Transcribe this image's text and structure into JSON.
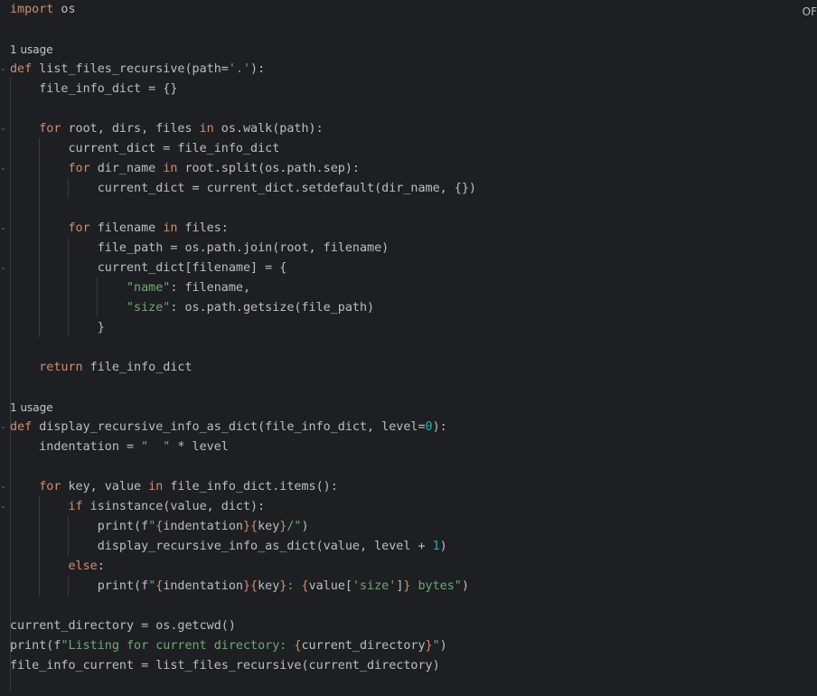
{
  "colors": {
    "background": "#1e1f22",
    "keyword": "#cf8e6d",
    "string": "#6aab73",
    "number": "#2aacb8",
    "text": "#bcbec4",
    "hint": "#c8c8c8"
  },
  "corner_label": "OF",
  "usage_hints": [
    "1 usage",
    "1 usage"
  ],
  "code_lines": [
    [
      {
        "t": "import",
        "c": "kw"
      },
      {
        "t": " os",
        "c": "plain"
      }
    ],
    [
      {
        "t": "def",
        "c": "kw"
      },
      {
        "t": " list_files_recursive(path=",
        "c": "plain"
      },
      {
        "t": "'.'",
        "c": "str"
      },
      {
        "t": "):",
        "c": "plain"
      }
    ],
    [
      {
        "t": "    file_info_dict = {}",
        "c": "plain"
      }
    ],
    [
      {
        "t": "    ",
        "c": "plain"
      },
      {
        "t": "for",
        "c": "kw"
      },
      {
        "t": " root, dirs, files ",
        "c": "plain"
      },
      {
        "t": "in",
        "c": "kw"
      },
      {
        "t": " os.walk(path):",
        "c": "plain"
      }
    ],
    [
      {
        "t": "        current_dict = file_info_dict",
        "c": "plain"
      }
    ],
    [
      {
        "t": "        ",
        "c": "plain"
      },
      {
        "t": "for",
        "c": "kw"
      },
      {
        "t": " dir_name ",
        "c": "plain"
      },
      {
        "t": "in",
        "c": "kw"
      },
      {
        "t": " root.split(os.path.sep):",
        "c": "plain"
      }
    ],
    [
      {
        "t": "            current_dict = current_dict.setdefault(dir_name, {})",
        "c": "plain"
      }
    ],
    [
      {
        "t": "        ",
        "c": "plain"
      },
      {
        "t": "for",
        "c": "kw"
      },
      {
        "t": " filename ",
        "c": "plain"
      },
      {
        "t": "in",
        "c": "kw"
      },
      {
        "t": " files:",
        "c": "plain"
      }
    ],
    [
      {
        "t": "            file_path = os.path.join(root, filename)",
        "c": "plain"
      }
    ],
    [
      {
        "t": "            current_dict[filename] = {",
        "c": "plain"
      }
    ],
    [
      {
        "t": "                ",
        "c": "plain"
      },
      {
        "t": "\"name\"",
        "c": "str"
      },
      {
        "t": ": filename,",
        "c": "plain"
      }
    ],
    [
      {
        "t": "                ",
        "c": "plain"
      },
      {
        "t": "\"size\"",
        "c": "str"
      },
      {
        "t": ": os.path.getsize(file_path)",
        "c": "plain"
      }
    ],
    [
      {
        "t": "            }",
        "c": "plain"
      }
    ],
    [
      {
        "t": "    ",
        "c": "plain"
      },
      {
        "t": "return",
        "c": "kw"
      },
      {
        "t": " file_info_dict",
        "c": "plain"
      }
    ],
    [
      {
        "t": "def",
        "c": "kw"
      },
      {
        "t": " display_recursive_info_as_dict(file_info_dict, level=",
        "c": "plain"
      },
      {
        "t": "0",
        "c": "num"
      },
      {
        "t": "):",
        "c": "plain"
      }
    ],
    [
      {
        "t": "    indentation = ",
        "c": "plain"
      },
      {
        "t": "\"  \"",
        "c": "str"
      },
      {
        "t": " * level",
        "c": "plain"
      }
    ],
    [
      {
        "t": "    ",
        "c": "plain"
      },
      {
        "t": "for",
        "c": "kw"
      },
      {
        "t": " key, value ",
        "c": "plain"
      },
      {
        "t": "in",
        "c": "kw"
      },
      {
        "t": " file_info_dict.items():",
        "c": "plain"
      }
    ],
    [
      {
        "t": "        ",
        "c": "plain"
      },
      {
        "t": "if",
        "c": "kw"
      },
      {
        "t": " isinstance(value, dict):",
        "c": "plain"
      }
    ],
    [
      {
        "t": "            print(f",
        "c": "plain"
      },
      {
        "t": "\"",
        "c": "str"
      },
      {
        "t": "{",
        "c": "kw"
      },
      {
        "t": "indentation",
        "c": "plain"
      },
      {
        "t": "}{",
        "c": "kw"
      },
      {
        "t": "key",
        "c": "plain"
      },
      {
        "t": "}",
        "c": "kw"
      },
      {
        "t": "/\"",
        "c": "str"
      },
      {
        "t": ")",
        "c": "plain"
      }
    ],
    [
      {
        "t": "            display_recursive_info_as_dict(value, level + ",
        "c": "plain"
      },
      {
        "t": "1",
        "c": "num"
      },
      {
        "t": ")",
        "c": "plain"
      }
    ],
    [
      {
        "t": "        ",
        "c": "plain"
      },
      {
        "t": "else",
        "c": "kw"
      },
      {
        "t": ":",
        "c": "plain"
      }
    ],
    [
      {
        "t": "            print(f",
        "c": "plain"
      },
      {
        "t": "\"",
        "c": "str"
      },
      {
        "t": "{",
        "c": "kw"
      },
      {
        "t": "indentation",
        "c": "plain"
      },
      {
        "t": "}{",
        "c": "kw"
      },
      {
        "t": "key",
        "c": "plain"
      },
      {
        "t": "}",
        "c": "kw"
      },
      {
        "t": ": ",
        "c": "str"
      },
      {
        "t": "{",
        "c": "kw"
      },
      {
        "t": "value[",
        "c": "plain"
      },
      {
        "t": "'size'",
        "c": "str"
      },
      {
        "t": "]",
        "c": "plain"
      },
      {
        "t": "}",
        "c": "kw"
      },
      {
        "t": " bytes\"",
        "c": "str"
      },
      {
        "t": ")",
        "c": "plain"
      }
    ],
    [
      {
        "t": "current_directory = os.getcwd()",
        "c": "plain"
      }
    ],
    [
      {
        "t": "print(f",
        "c": "plain"
      },
      {
        "t": "\"Listing for current directory: ",
        "c": "str"
      },
      {
        "t": "{",
        "c": "kw"
      },
      {
        "t": "current_directory",
        "c": "plain"
      },
      {
        "t": "}",
        "c": "kw"
      },
      {
        "t": "\"",
        "c": "str"
      },
      {
        "t": ")",
        "c": "plain"
      }
    ],
    [
      {
        "t": "file_info_current = list_files_recursive(current_directory)",
        "c": "plain"
      }
    ]
  ]
}
